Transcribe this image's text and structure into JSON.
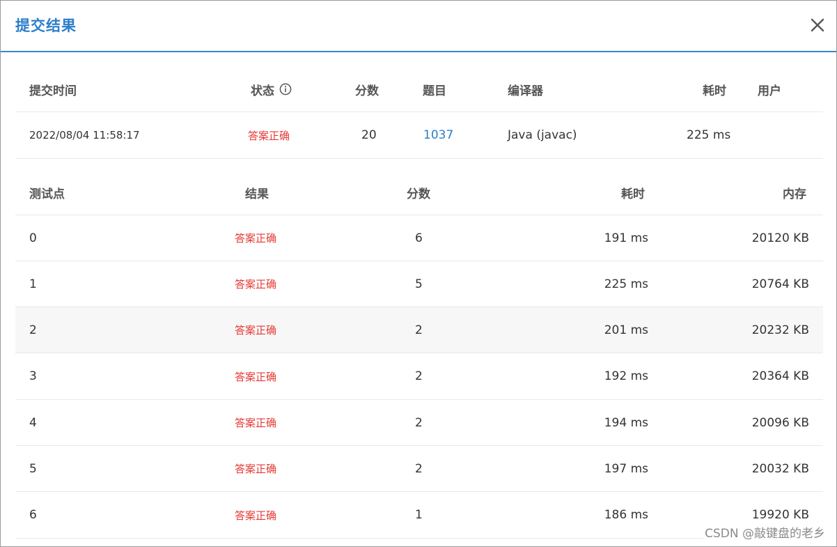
{
  "dialog": {
    "title": "提交结果",
    "close_icon": "close-icon"
  },
  "submission": {
    "headers": {
      "time": "提交时间",
      "status": "状态",
      "score": "分数",
      "problem": "题目",
      "compiler": "编译器",
      "elapsed": "耗时",
      "user": "用户"
    },
    "status_info_icon": "info-circle-icon",
    "row": {
      "time": "2022/08/04 11:58:17",
      "status": "答案正确",
      "score": "20",
      "problem": "1037",
      "compiler": "Java (javac)",
      "elapsed": "225 ms",
      "user": ""
    }
  },
  "testcases": {
    "headers": {
      "case": "测试点",
      "result": "结果",
      "score": "分数",
      "elapsed": "耗时",
      "memory": "内存"
    },
    "rows": [
      {
        "case": "0",
        "result": "答案正确",
        "score": "6",
        "elapsed": "191 ms",
        "memory": "20120 KB"
      },
      {
        "case": "1",
        "result": "答案正确",
        "score": "5",
        "elapsed": "225 ms",
        "memory": "20764 KB"
      },
      {
        "case": "2",
        "result": "答案正确",
        "score": "2",
        "elapsed": "201 ms",
        "memory": "20232 KB"
      },
      {
        "case": "3",
        "result": "答案正确",
        "score": "2",
        "elapsed": "192 ms",
        "memory": "20364 KB"
      },
      {
        "case": "4",
        "result": "答案正确",
        "score": "2",
        "elapsed": "194 ms",
        "memory": "20096 KB"
      },
      {
        "case": "5",
        "result": "答案正确",
        "score": "2",
        "elapsed": "197 ms",
        "memory": "20032 KB"
      },
      {
        "case": "6",
        "result": "答案正确",
        "score": "1",
        "elapsed": "186 ms",
        "memory": "19920 KB"
      }
    ]
  },
  "watermark": "CSDN @敲键盘的老乡",
  "colors": {
    "accent": "#2c7dc9",
    "success_text": "#e53935",
    "stripe": "#f7f7f7"
  }
}
